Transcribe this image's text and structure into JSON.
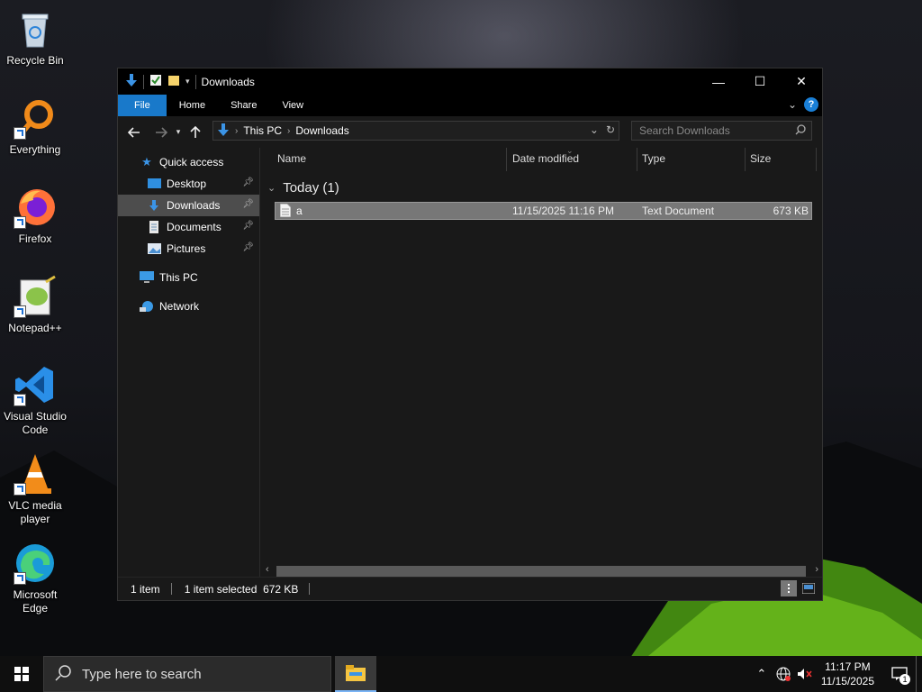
{
  "desktop": {
    "icons": [
      {
        "label": "Recycle Bin"
      },
      {
        "label": "Everything"
      },
      {
        "label": "Firefox"
      },
      {
        "label": "Notepad++"
      },
      {
        "label": "Visual Studio Code"
      },
      {
        "label": "VLC media player"
      },
      {
        "label": "Microsoft Edge"
      }
    ]
  },
  "window": {
    "title": "Downloads",
    "controls": {
      "minimize": "—",
      "maximize": "☐",
      "close": "✕"
    },
    "ribbon": {
      "tabs": [
        "File",
        "Home",
        "Share",
        "View"
      ],
      "help": "?"
    },
    "address": {
      "crumbs": [
        "This PC",
        "Downloads"
      ]
    },
    "search": {
      "placeholder": "Search Downloads"
    },
    "nav": {
      "quick_access": "Quick access",
      "items": [
        {
          "label": "Desktop",
          "pinned": true
        },
        {
          "label": "Downloads",
          "pinned": true,
          "selected": true
        },
        {
          "label": "Documents",
          "pinned": true
        },
        {
          "label": "Pictures",
          "pinned": true
        }
      ],
      "this_pc": "This PC",
      "network": "Network"
    },
    "columns": [
      "Name",
      "Date modified",
      "Type",
      "Size"
    ],
    "group": {
      "label": "Today (1)"
    },
    "files": [
      {
        "name": "a",
        "date": "11/15/2025 11:16 PM",
        "type": "Text Document",
        "size": "673 KB"
      }
    ],
    "status": {
      "count": "1 item",
      "selection": "1 item selected  672 KB"
    }
  },
  "taskbar": {
    "search_placeholder": "Type here to search",
    "time": "11:17 PM",
    "date": "11/15/2025",
    "notification_count": "1"
  },
  "colors": {
    "accent": "#1979ca",
    "window_bg": "#191919",
    "selected_row": "#777777"
  }
}
